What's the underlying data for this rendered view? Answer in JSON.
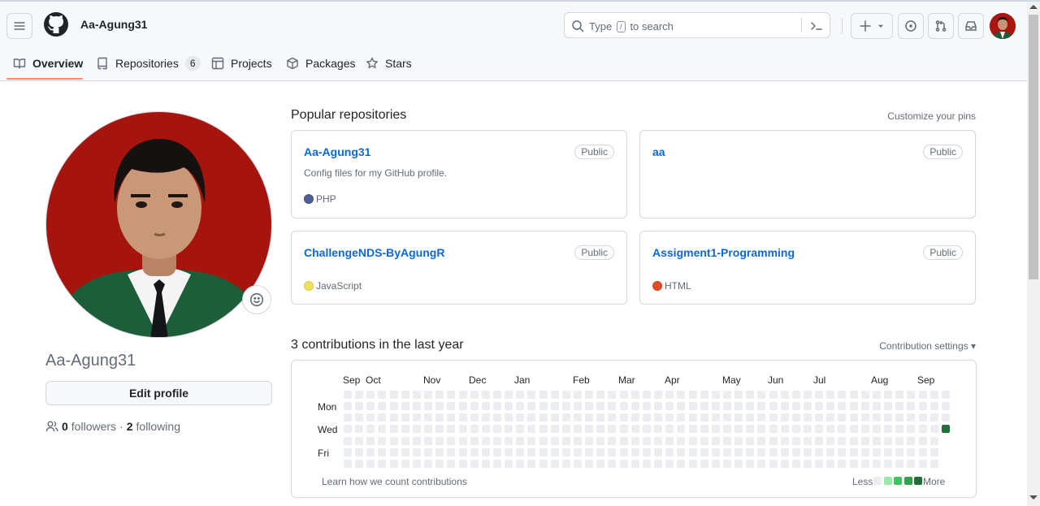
{
  "header": {
    "owner": "Aa-Agung31",
    "search_prefix": "Type",
    "search_key": "/",
    "search_suffix": "to search",
    "icons": [
      "menu-icon",
      "github-logo-icon",
      "search-icon",
      "command-palette-icon",
      "plus-icon",
      "caret-down-icon",
      "issues-icon",
      "pull-requests-icon",
      "inbox-icon"
    ]
  },
  "tabs": [
    {
      "label": "Overview",
      "active": true,
      "icon": "book-icon"
    },
    {
      "label": "Repositories",
      "count": "6",
      "icon": "repo-icon"
    },
    {
      "label": "Projects",
      "icon": "table-icon"
    },
    {
      "label": "Packages",
      "icon": "package-icon"
    },
    {
      "label": "Stars",
      "icon": "star-icon"
    }
  ],
  "profile": {
    "name": "Aa-Agung31",
    "edit_label": "Edit profile",
    "followers_count": "0",
    "followers_label": "followers",
    "dot": "·",
    "following_count": "2",
    "following_label": "following"
  },
  "popular": {
    "title": "Popular repositories",
    "customize": "Customize your pins",
    "repos": [
      {
        "name": "Aa-Agung31",
        "visibility": "Public",
        "description": "Config files for my GitHub profile.",
        "language": "PHP",
        "language_color": "#4f5d95"
      },
      {
        "name": "aa",
        "visibility": "Public",
        "description": "",
        "language": "",
        "language_color": ""
      },
      {
        "name": "ChallengeNDS-ByAgungR",
        "visibility": "Public",
        "description": "",
        "language": "JavaScript",
        "language_color": "#f1e05a"
      },
      {
        "name": "Assigment1-Programming",
        "visibility": "Public",
        "description": "",
        "language": "HTML",
        "language_color": "#e34c26"
      }
    ]
  },
  "contributions": {
    "title": "3 contributions in the last year",
    "settings": "Contribution settings ▾",
    "months": [
      "Sep",
      "Oct",
      "Nov",
      "Dec",
      "Jan",
      "Feb",
      "Mar",
      "Apr",
      "May",
      "Jun",
      "Jul",
      "Aug",
      "Sep"
    ],
    "days": [
      "Mon",
      "Wed",
      "Fri"
    ],
    "learn": "Learn how we count contributions",
    "less": "Less",
    "more": "More",
    "legend_colors": [
      "#ebedf0",
      "#9be9a8",
      "#40c463",
      "#30a14e",
      "#216e39"
    ],
    "active_cell": {
      "week": 53,
      "day": 3,
      "color": "#216e39"
    }
  }
}
